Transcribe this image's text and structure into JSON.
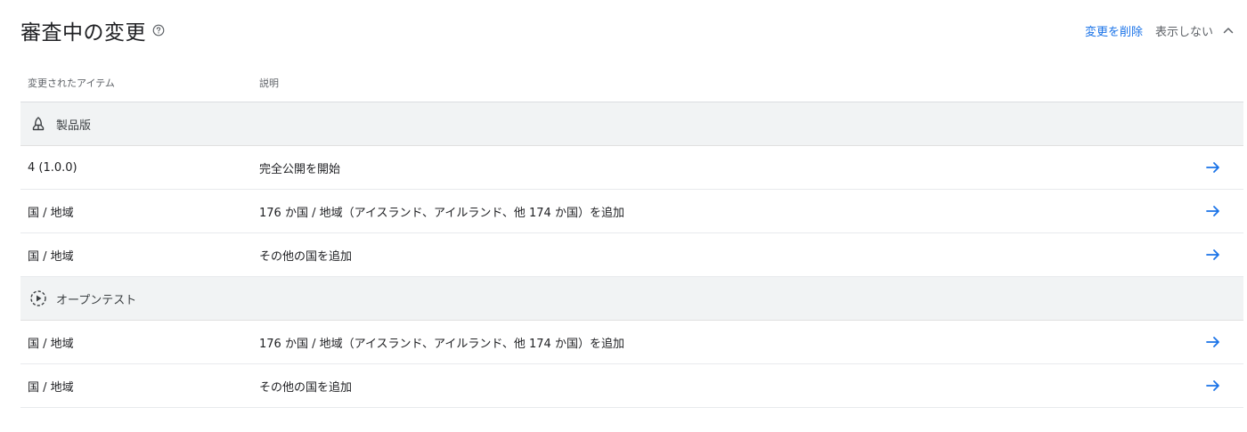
{
  "header": {
    "title": "審査中の変更",
    "delete_label": "変更を削除",
    "hide_label": "表示しない"
  },
  "table": {
    "columns": [
      "変更されたアイテム",
      "説明"
    ],
    "groups": [
      {
        "label": "製品版",
        "icon": "production-icon",
        "rows": [
          {
            "item": "4 (1.0.0)",
            "description": "完全公開を開始"
          },
          {
            "item": "国 / 地域",
            "description": "176 か国 / 地域（アイスランド、アイルランド、他 174 か国）を追加"
          },
          {
            "item": "国 / 地域",
            "description": "その他の国を追加"
          }
        ]
      },
      {
        "label": "オープンテスト",
        "icon": "open-testing-icon",
        "rows": [
          {
            "item": "国 / 地域",
            "description": "176 か国 / 地域（アイスランド、アイルランド、他 174 か国）を追加"
          },
          {
            "item": "国 / 地域",
            "description": "その他の国を追加"
          }
        ]
      }
    ]
  },
  "colors": {
    "accent": "#1a73e8",
    "group_bg": "#f1f3f4",
    "muted_text": "#5f6368"
  }
}
